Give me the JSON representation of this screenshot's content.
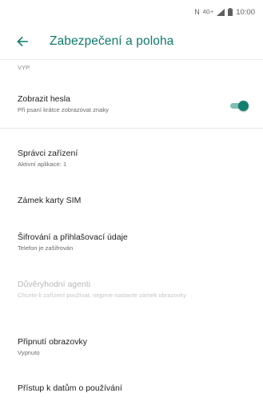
{
  "status_bar": {
    "network_label": "N",
    "signal_label": "4G+",
    "time": "10:00"
  },
  "app_bar": {
    "back_icon": "arrow-left-icon",
    "title": "Zabezpečení a poloha"
  },
  "list": {
    "partial_text": "VYP.",
    "items": [
      {
        "title": "Zobrazit hesla",
        "subtitle": "Při psaní krátce zobrazovat znaky",
        "toggle_on": true
      },
      {
        "title": "Správci zařízení",
        "subtitle": "Aktivní aplikace: 1"
      },
      {
        "title": "Zámek karty SIM",
        "subtitle": ""
      },
      {
        "title": "Šifrování a přihlašovací údaje",
        "subtitle": "Telefon je zašifrován"
      },
      {
        "title": "Důvěryhodní agenti",
        "subtitle": "Chcete-li zařízení používat, nejprve nastavte zámek obrazovky",
        "disabled": true
      },
      {
        "title": "Připnutí obrazovky",
        "subtitle": "Vypnuto"
      },
      {
        "title": "Přístup k datům o používání",
        "subtitle": ""
      }
    ]
  },
  "colors": {
    "accent": "#0f7a6c",
    "switch_thumb": "#13806f",
    "switch_track": "#7fbfb4"
  }
}
